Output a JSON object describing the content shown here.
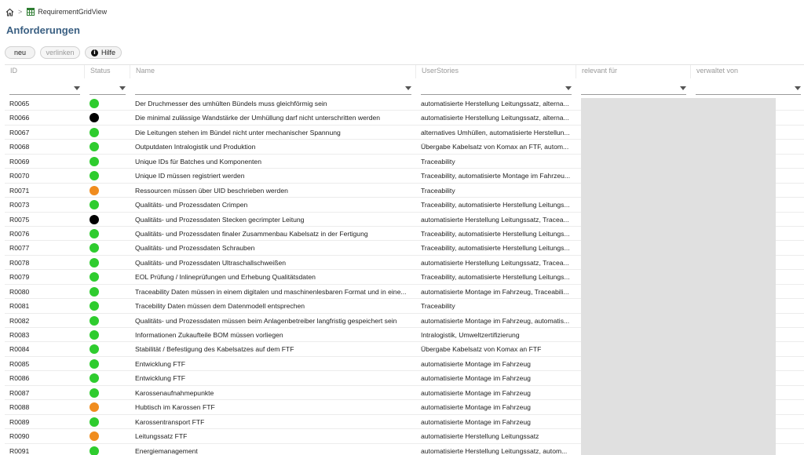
{
  "breadcrumb": {
    "home_icon": "home-icon",
    "separator": ">",
    "view_icon": "grid-icon",
    "view_name": "RequirementGridView"
  },
  "page_title": "Anforderungen",
  "toolbar": {
    "new_label": "neu",
    "link_label": "verlinken",
    "help_label": "Hilfe"
  },
  "columns": [
    "ID",
    "Status",
    "Name",
    "UserStories",
    "relevant für",
    "verwaltet von"
  ],
  "status_colors": {
    "green": "#2ecc2e",
    "black": "#000000",
    "orange": "#f08c1e"
  },
  "rows": [
    {
      "id": "R0065",
      "status": "green",
      "name": "Der Druchmesser des umhülten Bündels muss gleichförmig sein",
      "stories": "automatisierte Herstellung Leitungssatz, alterna..."
    },
    {
      "id": "R0066",
      "status": "black",
      "name": "Die minimal zulässige Wandstärke der Umhüllung darf nicht unterschritten werden",
      "stories": "automatisierte Herstellung Leitungssatz, alterna..."
    },
    {
      "id": "R0067",
      "status": "green",
      "name": "Die Leitungen stehen im Bündel nicht unter mechanischer Spannung",
      "stories": "alternatives Umhüllen, automatisierte Herstellun..."
    },
    {
      "id": "R0068",
      "status": "green",
      "name": "Outputdaten Intralogistik und Produktion",
      "stories": "Übergabe Kabelsatz von Komax an FTF, autom..."
    },
    {
      "id": "R0069",
      "status": "green",
      "name": "Unique IDs für Batches und Komponenten",
      "stories": "Traceability"
    },
    {
      "id": "R0070",
      "status": "green",
      "name": "Unique ID müssen registriert werden",
      "stories": "Traceability, automatisierte Montage im Fahrzeu..."
    },
    {
      "id": "R0071",
      "status": "orange",
      "name": "Ressourcen müssen über UID beschrieben werden",
      "stories": "Traceability"
    },
    {
      "id": "R0073",
      "status": "green",
      "name": "Qualitäts- und Prozessdaten Crimpen",
      "stories": "Traceability, automatisierte Herstellung Leitungs..."
    },
    {
      "id": "R0075",
      "status": "black",
      "name": "Qualitäts- und Prozessdaten Stecken gecrimpter Leitung",
      "stories": "automatisierte Herstellung Leitungssatz, Tracea..."
    },
    {
      "id": "R0076",
      "status": "green",
      "name": "Qualitäts- und Prozessdaten finaler Zusammenbau Kabelsatz in der Fertigung",
      "stories": "Traceability, automatisierte Herstellung Leitungs..."
    },
    {
      "id": "R0077",
      "status": "green",
      "name": "Qualitäts- und Prozessdaten Schrauben",
      "stories": "Traceability, automatisierte Herstellung Leitungs..."
    },
    {
      "id": "R0078",
      "status": "green",
      "name": "Qualitäts- und Prozessdaten Ultraschallschweißen",
      "stories": "automatisierte Herstellung Leitungssatz, Tracea..."
    },
    {
      "id": "R0079",
      "status": "green",
      "name": "EOL Prüfung / Inlineprüfungen und Erhebung Qualitätsdaten",
      "stories": "Traceability, automatisierte Herstellung Leitungs..."
    },
    {
      "id": "R0080",
      "status": "green",
      "name": "Traceability Daten müssen in einem digitalen und maschinenlesbaren Format und in eine...",
      "stories": "automatisierte Montage im Fahrzeug, Traceabili..."
    },
    {
      "id": "R0081",
      "status": "green",
      "name": "Tracebility Daten müssen dem Datenmodell entsprechen",
      "stories": "Traceability"
    },
    {
      "id": "R0082",
      "status": "green",
      "name": "Qualitäts- und Prozessdaten müssen beim Anlagenbetreiber langfristig gespeichert sein",
      "stories": "automatisierte Montage im Fahrzeug, automatis..."
    },
    {
      "id": "R0083",
      "status": "green",
      "name": "Informationen Zukaufteile BOM müssen vorliegen",
      "stories": "Intralogistik, Umweltzertifizierung"
    },
    {
      "id": "R0084",
      "status": "green",
      "name": "Stabilität / Befestigung des Kabelsatzes auf dem FTF",
      "stories": "Übergabe Kabelsatz von Komax an FTF"
    },
    {
      "id": "R0085",
      "status": "green",
      "name": "Entwicklung FTF",
      "stories": "automatisierte Montage im Fahrzeug"
    },
    {
      "id": "R0086",
      "status": "green",
      "name": "Entwicklung FTF",
      "stories": "automatisierte Montage im Fahrzeug"
    },
    {
      "id": "R0087",
      "status": "green",
      "name": "Karossenaufnahmepunkte",
      "stories": "automatisierte Montage im Fahrzeug"
    },
    {
      "id": "R0088",
      "status": "orange",
      "name": "Hubtisch im Karossen FTF",
      "stories": "automatisierte Montage im Fahrzeug"
    },
    {
      "id": "R0089",
      "status": "green",
      "name": "Karossentransport FTF",
      "stories": "automatisierte Montage im Fahrzeug"
    },
    {
      "id": "R0090",
      "status": "orange",
      "name": "Leitungssatz FTF",
      "stories": "automatisierte Herstellung Leitungssatz"
    },
    {
      "id": "R0091",
      "status": "green",
      "name": "Energiemanagement",
      "stories": "automatisierte Herstellung Leitungssatz, autom..."
    }
  ]
}
